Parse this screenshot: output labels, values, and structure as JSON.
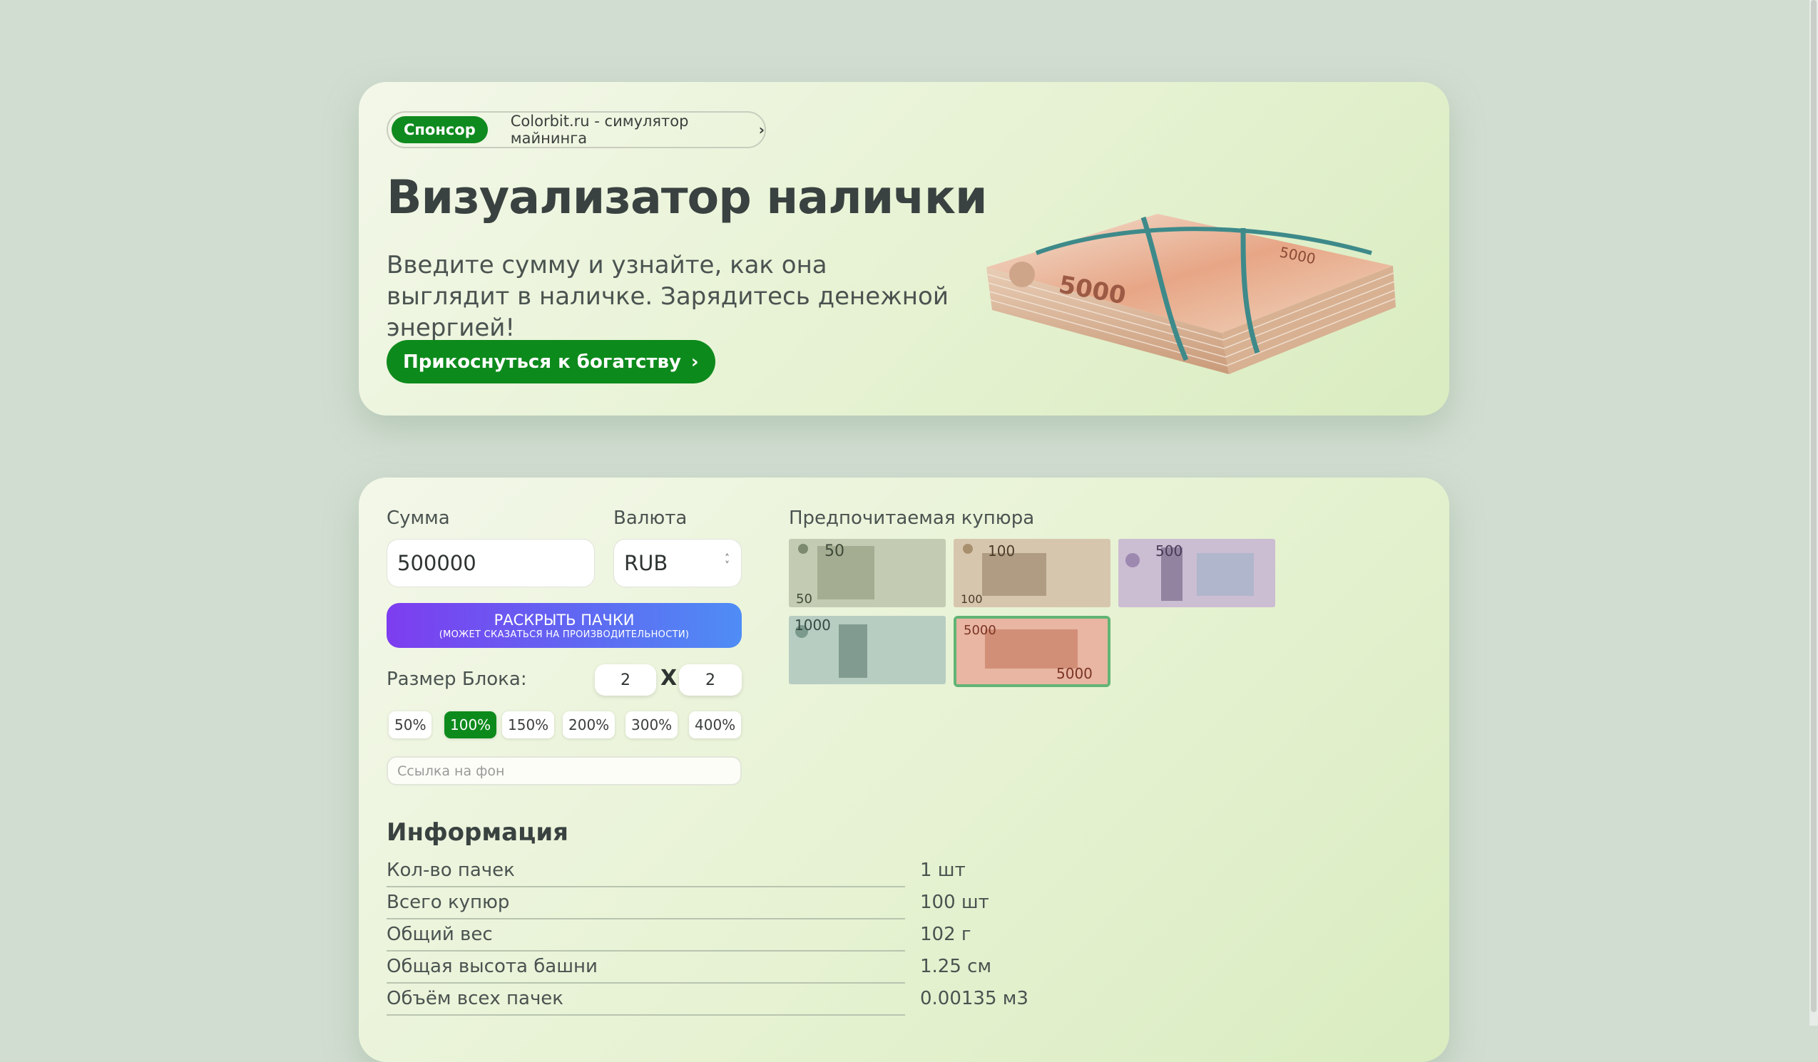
{
  "hero": {
    "sponsor_badge": "Спонсор",
    "sponsor_link": "Colorbit.ru - симулятор майнинга",
    "title": "Визуализатор налички",
    "subtitle": "Введите сумму и узнайте, как она выглядит в наличке. Зарядитесь денежной энергией!",
    "cta": "Прикоснуться к богатству"
  },
  "form": {
    "amount_label": "Сумма",
    "amount_value": "500000",
    "currency_label": "Валюта",
    "currency_value": "RUB",
    "reveal_main": "РАСКРЫТЬ ПАЧКИ",
    "reveal_sub": "(МОЖЕТ СКАЗАТЬСЯ НА ПРОИЗВОДИТЕЛЬНОСТИ)",
    "block_size_label": "Размер Блока:",
    "block_w": "2",
    "block_x": "X",
    "block_h": "2",
    "scales": [
      "50%",
      "100%",
      "150%",
      "200%",
      "300%",
      "400%"
    ],
    "active_scale": "100%",
    "bg_placeholder": "Ссылка на фон"
  },
  "notes": {
    "label": "Предпочитаемая купюра",
    "items": [
      {
        "value": "50",
        "color": "#b7c2a5"
      },
      {
        "value": "100",
        "color": "#c9b49b"
      },
      {
        "value": "500",
        "color": "#bcaec3"
      },
      {
        "value": "1000",
        "color": "#a9c0b5"
      },
      {
        "value": "5000",
        "color": "#e2a48e"
      }
    ],
    "selected": "5000"
  },
  "info": {
    "title": "Информация",
    "rows": [
      {
        "key": "Кол-во пачек",
        "value": "1 шт"
      },
      {
        "key": "Всего купюр",
        "value": "100 шт"
      },
      {
        "key": "Общий вес",
        "value": "102 г"
      },
      {
        "key": "Общая высота башни",
        "value": "1.25 см"
      },
      {
        "key": "Объём всех пачек",
        "value": "0.00135 м3"
      }
    ]
  },
  "colors": {
    "accent_green": "#0d8a1c",
    "gradient_start": "#7d3df0",
    "gradient_end": "#4f8df5"
  }
}
